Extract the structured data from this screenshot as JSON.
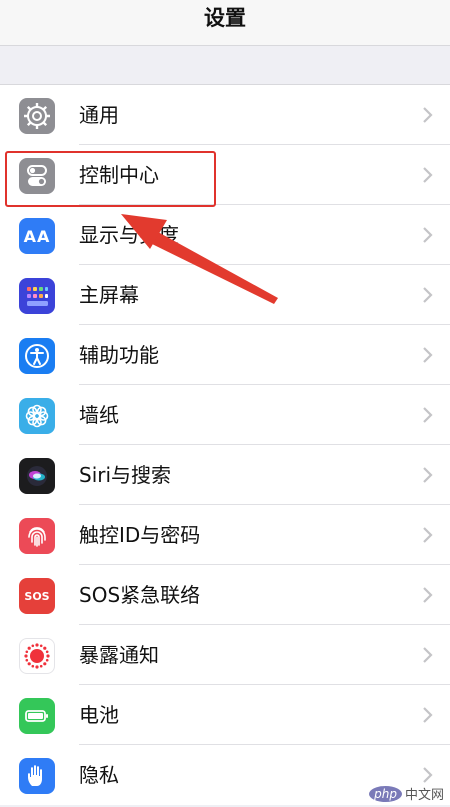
{
  "header": {
    "title": "设置"
  },
  "settings": {
    "items": [
      {
        "label": "通用",
        "icon": "gear-icon",
        "color": "#8e8e93"
      },
      {
        "label": "控制中心",
        "icon": "toggles-icon",
        "color": "#8e8e93"
      },
      {
        "label": "显示与亮度",
        "icon": "aa-icon",
        "icon_text": "AA",
        "color": "#2f7cf6"
      },
      {
        "label": "主屏幕",
        "icon": "grid-icon",
        "color": "#3b43d9"
      },
      {
        "label": "辅助功能",
        "icon": "accessibility-icon",
        "color": "#1a7df2"
      },
      {
        "label": "墙纸",
        "icon": "flower-icon",
        "color": "#3aaee8"
      },
      {
        "label": "Siri与搜索",
        "icon": "siri-icon",
        "color": "#1c1c1e"
      },
      {
        "label": "触控ID与密码",
        "icon": "fingerprint-icon",
        "color": "#ec4a57"
      },
      {
        "label": "SOS紧急联络",
        "icon": "sos-icon",
        "icon_text": "SOS",
        "color": "#e5403a"
      },
      {
        "label": "暴露通知",
        "icon": "exposure-icon",
        "color": "#ffffff"
      },
      {
        "label": "电池",
        "icon": "battery-icon",
        "color": "#34c759"
      },
      {
        "label": "隐私",
        "icon": "hand-icon",
        "color": "#2f7cf6"
      }
    ]
  },
  "annotation": {
    "highlight_color": "#e0322c"
  },
  "watermark": {
    "php": "php",
    "text": "中文网"
  }
}
